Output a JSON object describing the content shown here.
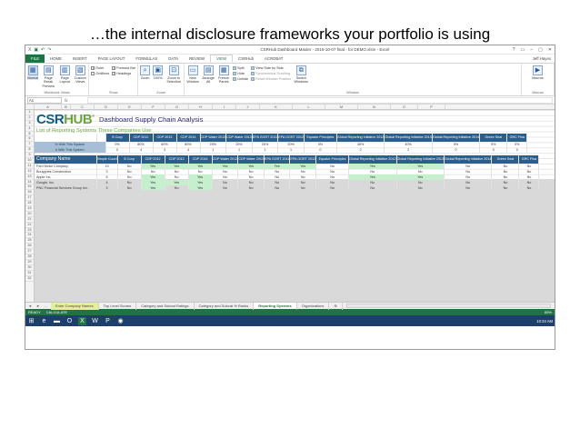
{
  "slide_title": "…the internal disclosure frameworks your portfolio is using",
  "window": {
    "title": "CSRHub Dashboard Master - 2015-10-07 final - for DEMO.xlsm - Excel",
    "controls": [
      "?",
      "▭",
      "–",
      "▢",
      "✕"
    ]
  },
  "qat_icons": [
    "excel-icon",
    "save-icon",
    "undo-icon",
    "redo-icon"
  ],
  "menu": {
    "tabs": [
      "FILE",
      "HOME",
      "INSERT",
      "PAGE LAYOUT",
      "FORMULAS",
      "DATA",
      "REVIEW",
      "VIEW",
      "CSRHub",
      "ACROBAT"
    ],
    "active": "VIEW",
    "user": "Jeff Hayes"
  },
  "ribbon": {
    "workbook_views": {
      "label": "Workbook Views",
      "buttons": [
        "Normal",
        "Page Break Preview",
        "Page Layout",
        "Custom Views"
      ]
    },
    "show": {
      "label": "Show",
      "checks": [
        {
          "label": "Ruler",
          "checked": true
        },
        {
          "label": "Formula Bar",
          "checked": true
        },
        {
          "label": "Gridlines",
          "checked": false
        },
        {
          "label": "Headings",
          "checked": true
        }
      ]
    },
    "zoom": {
      "label": "Zoom",
      "buttons": [
        "Zoom",
        "100%",
        "Zoom to Selection"
      ]
    },
    "window": {
      "label": "Window",
      "buttons": [
        "New Window",
        "Arrange All",
        "Freeze Panes"
      ],
      "small": [
        "Split",
        "Hide",
        "Unhide",
        "View Side by Side",
        "Synchronous Scrolling",
        "Reset Window Position"
      ],
      "switch": "Switch Windows"
    },
    "macros": {
      "label": "Macros",
      "button": "Macros"
    }
  },
  "formula_bar": {
    "name_box": "A1",
    "fx": "fx",
    "value": ""
  },
  "columns": [
    "A",
    "B",
    "C",
    "D",
    "E",
    "F",
    "G",
    "H",
    "I",
    "J",
    "K",
    "L",
    "M",
    "N",
    "O",
    "P"
  ],
  "rows": [
    "1",
    "2",
    "3",
    "4",
    "5",
    "6",
    "7",
    "8",
    "9",
    "10",
    "11",
    "12",
    "13",
    "14",
    "15",
    "16",
    "17",
    "18",
    "19",
    "20",
    "21",
    "22",
    "23",
    "24",
    "25",
    "26",
    "27",
    "28",
    "29",
    "30",
    "31",
    "32"
  ],
  "dashboard": {
    "logo_a": "CSR",
    "logo_b": "HUB",
    "logo_mark": "®",
    "title": "Dashboard Supply Chain Analysis",
    "subtitle": "List of Reporting Systems These Companies Use"
  },
  "systems": [
    "B Corp",
    "CDP 2012",
    "CDP 2013",
    "CDP 2014",
    "CDP Water 2012",
    "CDP Water 2013",
    "EPA GGRT 2011",
    "EPA GGRT 2012",
    "Equator Principles",
    "Global Reporting Initiative 2012",
    "Global Reporting Initiative 2013",
    "Global Reporting Initiative 2014",
    "Green Seal",
    "GRC Fina"
  ],
  "stats": [
    {
      "label": "% With This System",
      "values": [
        "0%",
        "80%",
        "60%",
        "80%",
        "20%",
        "20%",
        "20%",
        "20%",
        "0%",
        "40%",
        "40%",
        "0%",
        "0%",
        "0%"
      ]
    },
    {
      "label": "# With This System",
      "values": [
        "0",
        "4",
        "3",
        "4",
        "1",
        "1",
        "1",
        "1",
        "0",
        "2",
        "2",
        "0",
        "0",
        "0"
      ]
    }
  ],
  "company_header": {
    "name": "Company Name",
    "count": "Simple Count"
  },
  "companies": [
    {
      "name": "Ford Motor Company",
      "count": "10",
      "values": [
        "No",
        "Yes",
        "Yes",
        "Yes",
        "Yes",
        "Yes",
        "Yes",
        "Yes",
        "No",
        "Yes",
        "Yes",
        "No",
        "No",
        "No"
      ]
    },
    {
      "name": "Bouygues Construction",
      "count": "3",
      "values": [
        "No",
        "No",
        "No",
        "No",
        "No",
        "No",
        "No",
        "No",
        "No",
        "No",
        "No",
        "No",
        "No",
        "No"
      ]
    },
    {
      "name": "Apple Inc.",
      "count": "6",
      "values": [
        "No",
        "Yes",
        "No",
        "Yes",
        "No",
        "No",
        "No",
        "No",
        "No",
        "Yes",
        "Yes",
        "No",
        "No",
        "No"
      ]
    },
    {
      "name": "Google, Inc.",
      "count": "4",
      "values": [
        "No",
        "Yes",
        "Yes",
        "Yes",
        "No",
        "No",
        "No",
        "No",
        "No",
        "No",
        "No",
        "No",
        "No",
        "No"
      ]
    },
    {
      "name": "PNC Financial Services Group Inc.",
      "count": "3",
      "values": [
        "No",
        "Yes",
        "No",
        "Yes",
        "No",
        "No",
        "No",
        "No",
        "No",
        "No",
        "No",
        "No",
        "No",
        "No"
      ]
    }
  ],
  "sheet_tabs": {
    "nav": [
      "◄",
      "►",
      "..."
    ],
    "tabs": [
      "Enter Company Names",
      "Top Level Scores",
      "Category and Subcat Ratings",
      "Category and Subcat % Ranks",
      "Reporting Systems",
      "Organizations"
    ],
    "highlighted": "Enter Company Names",
    "active": "Reporting Systems",
    "add": "⊕"
  },
  "status": {
    "ready": "READY",
    "calc": "CALCULATE",
    "zoom": "85%"
  },
  "taskbar": {
    "icons": [
      "windows-icon",
      "ie-icon",
      "folder-icon",
      "outlook-icon",
      "excel-icon",
      "word-icon",
      "powerpoint-icon",
      "chrome-icon"
    ],
    "time": "10:34 AM"
  },
  "colors": {
    "excel_green": "#217346",
    "header_blue": "#2b5e8a",
    "stat_blue": "#a7bfd6",
    "yes_green": "#c6efce",
    "brand_blue": "#0e5d85",
    "brand_green": "#6ba43a"
  }
}
